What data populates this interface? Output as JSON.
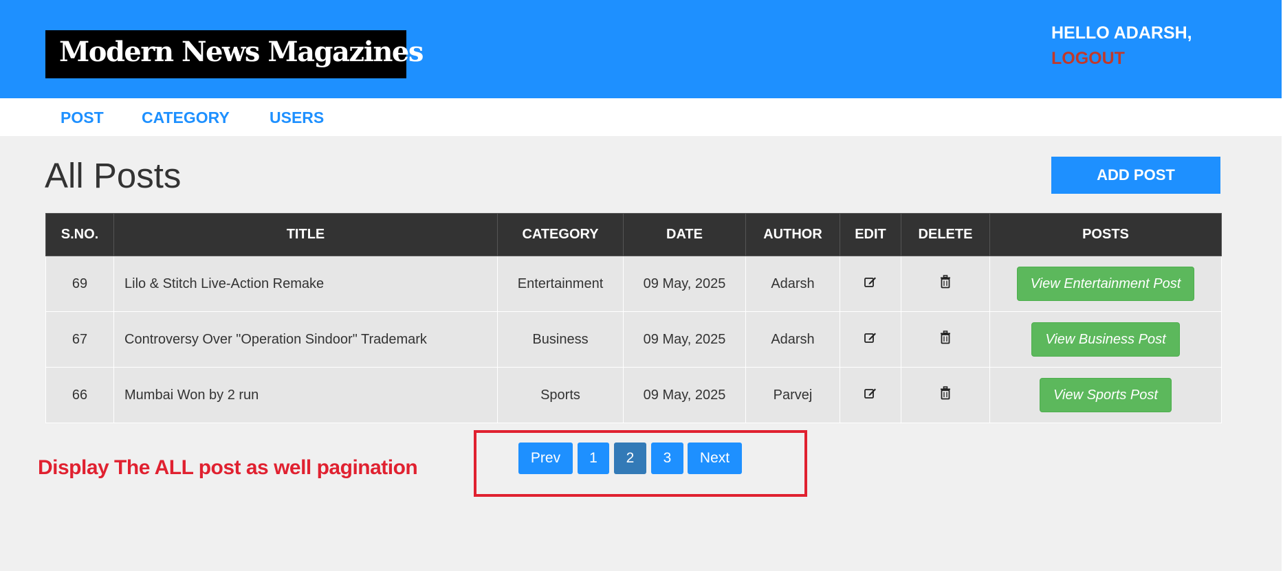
{
  "header": {
    "logo": "Modern News Magazines",
    "greeting": "HELLO ADARSH,",
    "logout": "LOGOUT"
  },
  "nav": {
    "items": [
      "POST",
      "CATEGORY",
      "USERS"
    ]
  },
  "main": {
    "title": "All Posts",
    "add_button": "ADD POST"
  },
  "table": {
    "columns": [
      "S.NO.",
      "TITLE",
      "CATEGORY",
      "DATE",
      "AUTHOR",
      "EDIT",
      "DELETE",
      "POSTS"
    ],
    "rows": [
      {
        "sno": "69",
        "title": "Lilo & Stitch Live-Action Remake",
        "category": "Entertainment",
        "date": "09 May, 2025",
        "author": "Adarsh",
        "view": "View Entertainment Post"
      },
      {
        "sno": "67",
        "title": "Controversy Over \"Operation Sindoor\" Trademark",
        "category": "Business",
        "date": "09 May, 2025",
        "author": "Adarsh",
        "view": "View Business Post"
      },
      {
        "sno": "66",
        "title": "Mumbai Won by 2 run",
        "category": "Sports",
        "date": "09 May, 2025",
        "author": "Parvej",
        "view": "View Sports Post"
      }
    ]
  },
  "pagination": {
    "prev": "Prev",
    "pages": [
      "1",
      "2",
      "3"
    ],
    "current": "2",
    "next": "Next"
  },
  "annotation": "Display The ALL post as well pagination",
  "colors": {
    "header_bg": "#1e90ff",
    "logout": "#c0392b",
    "view_button": "#5cb85c",
    "active_page": "#337ab7",
    "annotation": "#e02130"
  },
  "icons": {
    "edit": "edit-icon",
    "delete": "trash-icon"
  }
}
